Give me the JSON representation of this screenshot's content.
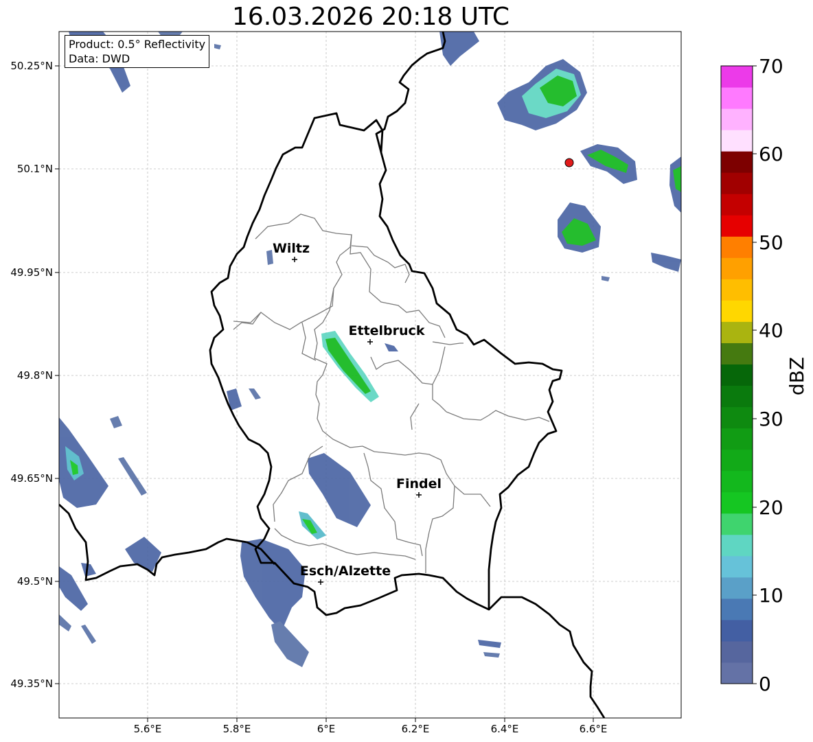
{
  "title": "16.03.2026 20:18 UTC",
  "info": {
    "product": "Product: 0.5° Reflectivity",
    "data_source": "Data: DWD"
  },
  "lat_ticks": [
    "50.25°N",
    "50.1°N",
    "49.95°N",
    "49.8°N",
    "49.65°N",
    "49.5°N",
    "49.35°N"
  ],
  "lon_ticks": [
    "5.6°E",
    "5.8°E",
    "6°E",
    "6.2°E",
    "6.4°E",
    "6.6°E"
  ],
  "cities": [
    {
      "name": "Wiltz",
      "lon": 5.93,
      "lat": 49.966
    },
    {
      "name": "Ettelbruck",
      "lon": 6.1,
      "lat": 49.847
    },
    {
      "name": "Findel",
      "lon": 6.21,
      "lat": 49.627
    },
    {
      "name": "Esch/Alzette",
      "lon": 5.98,
      "lat": 49.499
    }
  ],
  "radar_site": {
    "lon": 6.55,
    "lat": 50.11,
    "color": "#e11b1b"
  },
  "colorbar": {
    "label": "dBZ",
    "ticks": [
      "0",
      "10",
      "20",
      "30",
      "40",
      "50",
      "60",
      "70"
    ],
    "colors": [
      "#6472a6",
      "#56669e",
      "#435fa3",
      "#4a79b4",
      "#5aa0c8",
      "#66c2d9",
      "#5fd6c2",
      "#3fd46e",
      "#15c622",
      "#13b81d",
      "#12aa18",
      "#119c14",
      "#0e8a10",
      "#0a7a0d",
      "#066709",
      "#457a10",
      "#aab410",
      "#ffd700",
      "#ffbe00",
      "#ffa000",
      "#ff7f00",
      "#e60000",
      "#c40000",
      "#a10000",
      "#7d0000",
      "#ffe0ff",
      "#ffb2ff",
      "#ff7aff",
      "#ec3ae9"
    ]
  }
}
